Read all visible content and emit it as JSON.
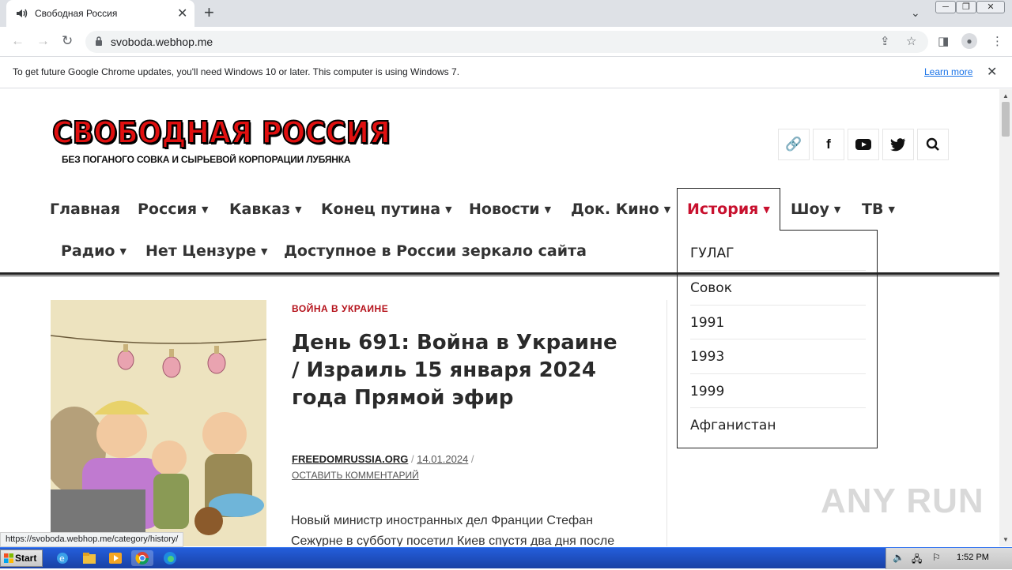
{
  "browser": {
    "tab_title": "Свободная Россия",
    "tab_close": "✕",
    "new_tab": "+",
    "url": "svoboda.webhop.me",
    "infobar_message": "To get future Google Chrome updates, you'll need Windows 10 or later. This computer is using Windows 7.",
    "infobar_link": "Learn more",
    "status_url": "https://svoboda.webhop.me/category/history/"
  },
  "site": {
    "logo_title": "СВОБОДНАЯ РОССИЯ",
    "logo_subtitle": "БЕЗ ПОГАНОГО СОВКА И СЫРЬЕВОЙ КОРПОРАЦИИ ЛУБЯНКА",
    "social_icons": [
      "link-icon",
      "facebook-icon",
      "youtube-icon",
      "twitter-icon",
      "search-icon"
    ]
  },
  "nav": {
    "items": [
      {
        "label": "Главная",
        "has_arrow": false
      },
      {
        "label": "Россия",
        "has_arrow": true
      },
      {
        "label": "Кавказ",
        "has_arrow": true
      },
      {
        "label": "Конец путина",
        "has_arrow": true
      },
      {
        "label": "Новости",
        "has_arrow": true
      },
      {
        "label": "Док. Кино",
        "has_arrow": true
      },
      {
        "label": "История",
        "has_arrow": true,
        "active": true
      },
      {
        "label": "Шоу",
        "has_arrow": true
      },
      {
        "label": "ТВ",
        "has_arrow": true
      },
      {
        "label": "Радио",
        "has_arrow": true
      },
      {
        "label": "Нет Цензуре",
        "has_arrow": true
      },
      {
        "label": "Доступное в России зеркало сайта",
        "has_arrow": false
      }
    ],
    "arrow": "▼",
    "active_color": "#c8102e",
    "dropdown": [
      "ГУЛАГ",
      "Совок",
      "1991",
      "1993",
      "1999",
      "Афганистан"
    ]
  },
  "article": {
    "category": "ВОЙНА В УКРАИНЕ",
    "title": "День 691: Война в Украине / Израиль 15 января 2024 года Прямой эфир",
    "author": "FREEDOMRUSSIA.ORG",
    "separator": "/",
    "date": "14.01.2024",
    "comments": "ОСТАВИТЬ КОММЕНТАРИЙ",
    "excerpt": "Новый министр иностранных дел Франции Стефан Сежурне в субботу посетил Киев спустя два дня после"
  },
  "watermark": "ANY RUN",
  "taskbar": {
    "start": "Start",
    "clock": "1:52 PM"
  }
}
